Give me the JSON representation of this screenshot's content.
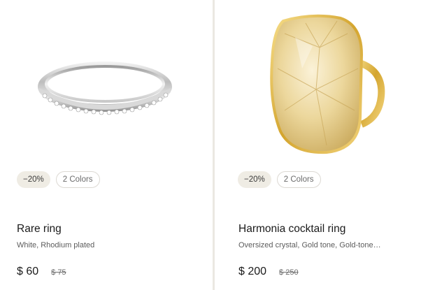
{
  "products": [
    {
      "discount_badge": "−20%",
      "colors_badge": "2 Colors",
      "name": "Rare ring",
      "description": "White, Rhodium plated",
      "price": "$ 60",
      "original_price": "$ 75",
      "image_icon": "silver-ring-icon"
    },
    {
      "discount_badge": "−20%",
      "colors_badge": "2 Colors",
      "name": "Harmonia cocktail ring",
      "description": "Oversized crystal, Gold tone, Gold-tone…",
      "price": "$ 200",
      "original_price": "$ 250",
      "image_icon": "gold-crystal-ring-icon"
    }
  ],
  "colors": {
    "card_background": "#ffffff",
    "divider": "#ebe8e2",
    "discount_badge_bg": "#efece4",
    "text_primary": "#1a1a1a",
    "text_secondary": "#5c5c5c"
  }
}
